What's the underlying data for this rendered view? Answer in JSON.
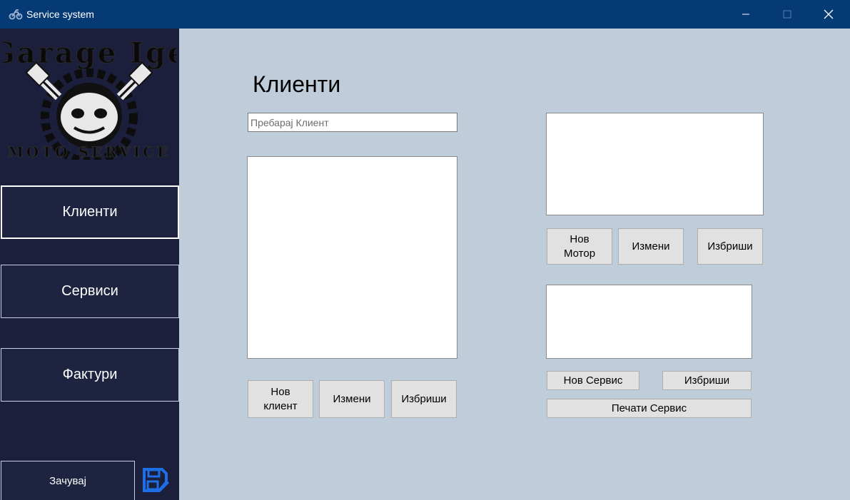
{
  "window": {
    "title": "Service system",
    "controls": [
      "minimize",
      "maximize",
      "close"
    ]
  },
  "sidebar": {
    "logo_text": "Garage Ige",
    "logo_subtext": "MOTO SERVICE",
    "items": [
      {
        "label": "Клиенти",
        "active": true
      },
      {
        "label": "Сервиси",
        "active": false
      },
      {
        "label": "Фактури",
        "active": false
      }
    ],
    "save_label": "Зачувај",
    "save_icon": "floppy-disk-edit-icon"
  },
  "main": {
    "title": "Клиенти",
    "search": {
      "placeholder": "Пребарај Клиент",
      "value": ""
    },
    "clients": {
      "items": [],
      "buttons": {
        "new": "Нов клиент",
        "edit": "Измени",
        "delete": "Избриши"
      }
    },
    "motors": {
      "items": [],
      "buttons": {
        "new": "Нов Мотор",
        "edit": "Измени",
        "delete": "Избриши"
      }
    },
    "services": {
      "items": [],
      "buttons": {
        "new": "Нов Сервис",
        "delete": "Избриши",
        "print": "Печати Сервис"
      }
    }
  },
  "colors": {
    "titlebar": "#063a74",
    "sidebar": "#1b1f3b",
    "background": "#bfccda",
    "save_icon": "#1e6fe6"
  }
}
